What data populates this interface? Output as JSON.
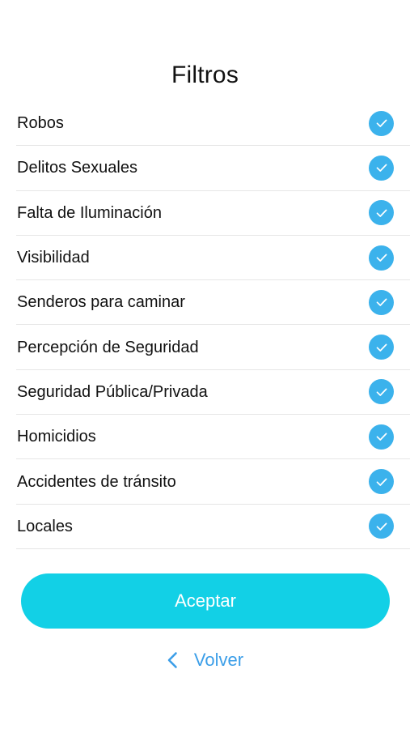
{
  "header": {
    "title": "Filtros"
  },
  "filters": [
    {
      "label": "Robos",
      "checked": true
    },
    {
      "label": "Delitos Sexuales",
      "checked": true
    },
    {
      "label": "Falta de Iluminación",
      "checked": true
    },
    {
      "label": "Visibilidad",
      "checked": true
    },
    {
      "label": "Senderos para caminar",
      "checked": true
    },
    {
      "label": "Percepción de Seguridad",
      "checked": true
    },
    {
      "label": "Seguridad Pública/Privada",
      "checked": true
    },
    {
      "label": "Homicidios",
      "checked": true
    },
    {
      "label": "Accidentes de tránsito",
      "checked": true
    },
    {
      "label": "Locales",
      "checked": true
    }
  ],
  "actions": {
    "accept_label": "Aceptar",
    "back_label": "Volver"
  },
  "icons": {
    "check": "check-circle-icon",
    "back": "chevron-left-icon"
  },
  "colors": {
    "check_fill": "#3bb2ec",
    "accept_button": "#12d0e6",
    "back_link": "#3b9ee8",
    "divider": "#e6e6e6"
  }
}
